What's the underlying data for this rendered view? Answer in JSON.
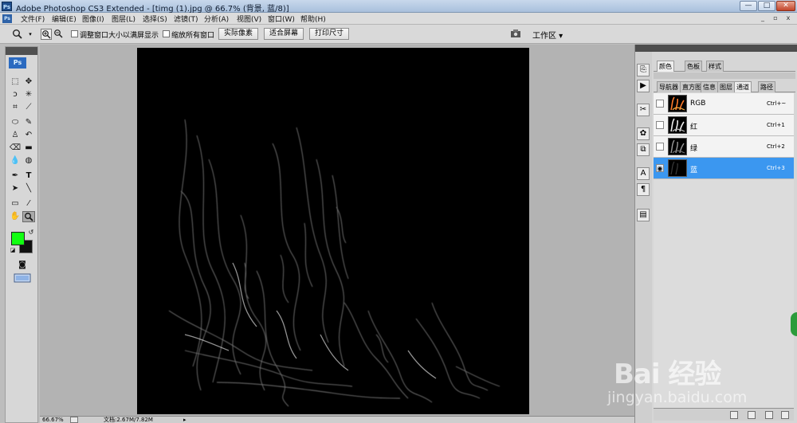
{
  "titlebar": {
    "title": "Adobe Photoshop CS3 Extended - [timg (1).jpg @ 66.7% (背景, 蓝/8)]",
    "app_icon": "Ps",
    "minimize": "—",
    "maximize": "□",
    "close": "✕"
  },
  "menubar": {
    "items": [
      "文件(F)",
      "编辑(E)",
      "图像(I)",
      "图层(L)",
      "选择(S)",
      "滤镜(T)",
      "分析(A)",
      "视图(V)",
      "窗口(W)",
      "帮助(H)"
    ],
    "doc_minimize": "_",
    "doc_restore": "▫",
    "doc_close": "x"
  },
  "options": {
    "checkbox1": "调整窗口大小以满屏显示",
    "checkbox2": "缩放所有窗口",
    "btn_actual": "实际像素",
    "btn_fit": "适合屏幕",
    "btn_print": "打印尺寸",
    "workspace": "工作区 ▾"
  },
  "toolbox": {
    "logo": "Ps",
    "foreground_color": "#11ff11",
    "background_color": "#111111"
  },
  "status": {
    "zoom": "66.67%",
    "doc": "文档:2.67M/7.82M"
  },
  "panels": {
    "tabs_top": [
      "颜色",
      "色板",
      "样式"
    ],
    "tabs_mid": [
      "导航器",
      "直方图",
      "信息",
      "图层",
      "通道",
      "路径"
    ],
    "channels": [
      {
        "name": "RGB",
        "shortcut": "Ctrl+~"
      },
      {
        "name": "红",
        "shortcut": "Ctrl+1"
      },
      {
        "name": "绿",
        "shortcut": "Ctrl+2"
      },
      {
        "name": "蓝",
        "shortcut": "Ctrl+3"
      }
    ]
  },
  "watermark": {
    "main": "Bai 经验",
    "sub": "jingyan.baidu.com"
  }
}
